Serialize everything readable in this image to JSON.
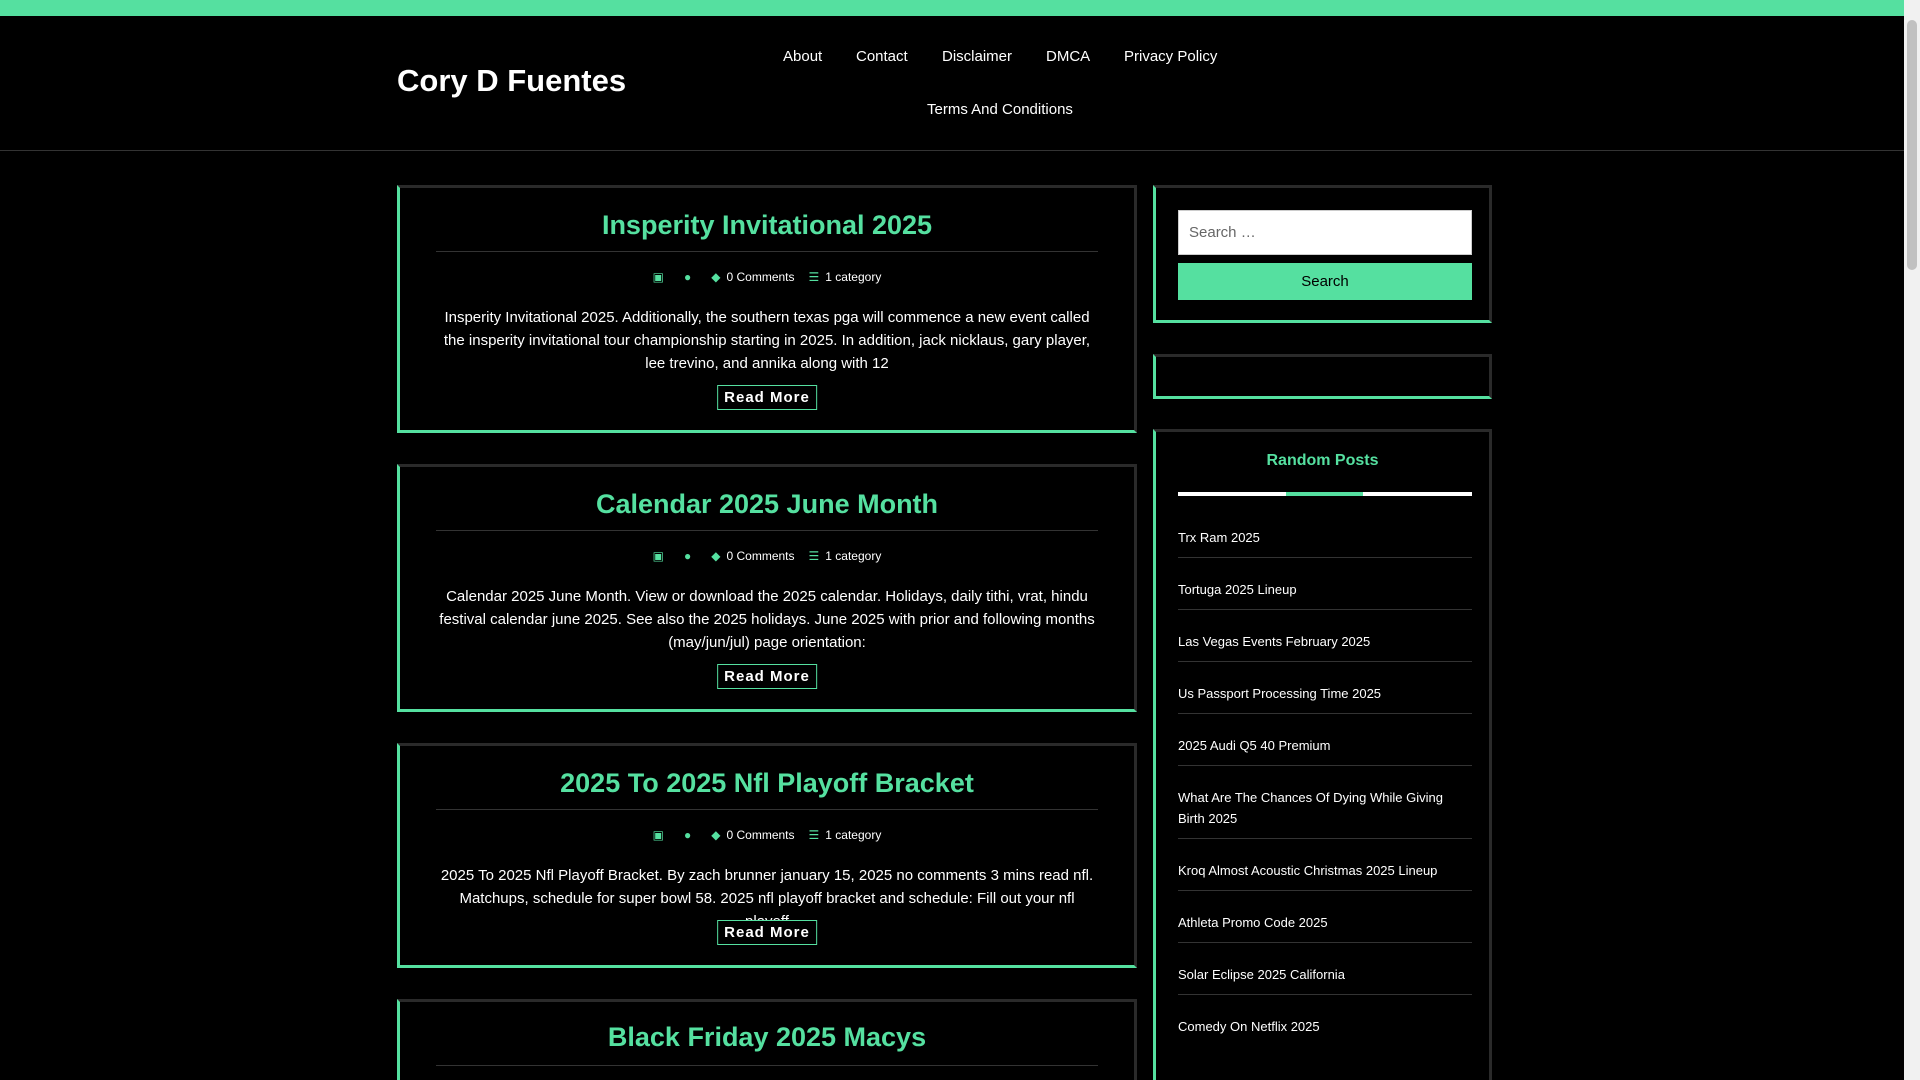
{
  "site": {
    "title": "Cory D Fuentes"
  },
  "nav": {
    "items": [
      "About",
      "Contact",
      "Disclaimer",
      "DMCA",
      "Privacy Policy",
      "Terms And Conditions"
    ]
  },
  "posts": [
    {
      "title": "Insperity Invitational 2025",
      "comments": "0 Comments",
      "category": "1 category",
      "excerpt": "Insperity Invitational 2025. Additionally, the southern texas pga will commence a new event called the insperity invitational tour championship starting in 2025. In addition, jack nicklaus, gary player, lee trevino, and annika along with 12",
      "read_more": "Read More"
    },
    {
      "title": "Calendar 2025 June Month",
      "comments": "0 Comments",
      "category": "1 category",
      "excerpt": "Calendar 2025 June Month. View or download the 2025 calendar. Holidays, daily tithi, vrat, hindu festival calendar june 2025. See also the 2025 holidays. June 2025 with prior and following months (may/jun/jul) page orientation:",
      "read_more": "Read More"
    },
    {
      "title": "2025 To 2025 Nfl Playoff Bracket",
      "comments": "0 Comments",
      "category": "1 category",
      "excerpt": "2025 To 2025 Nfl Playoff Bracket. By zach brunner january 15, 2025 no comments 3 mins read nfl. Matchups, schedule for super bowl 58. 2025 nfl playoff bracket and schedule: Fill out your nfl playoff",
      "read_more": "Read More"
    },
    {
      "title": "Black Friday 2025 Macys"
    }
  ],
  "sidebar": {
    "search": {
      "placeholder": "Search …",
      "button": "Search"
    },
    "random_posts": {
      "title": "Random Posts",
      "items": [
        "Trx Ram 2025",
        "Tortuga 2025 Lineup",
        "Las Vegas Events February 2025",
        "Us Passport Processing Time 2025",
        "2025 Audi Q5 40 Premium",
        "What Are The Chances Of Dying While Giving Birth 2025",
        "Kroq Almost Acoustic Christmas 2025 Lineup",
        "Athleta Promo Code 2025",
        "Solar Eclipse 2025 California",
        "Comedy On Netflix 2025"
      ]
    }
  },
  "colors": {
    "accent": "#55e0a0",
    "background": "#000000",
    "text": "#ffffff"
  }
}
